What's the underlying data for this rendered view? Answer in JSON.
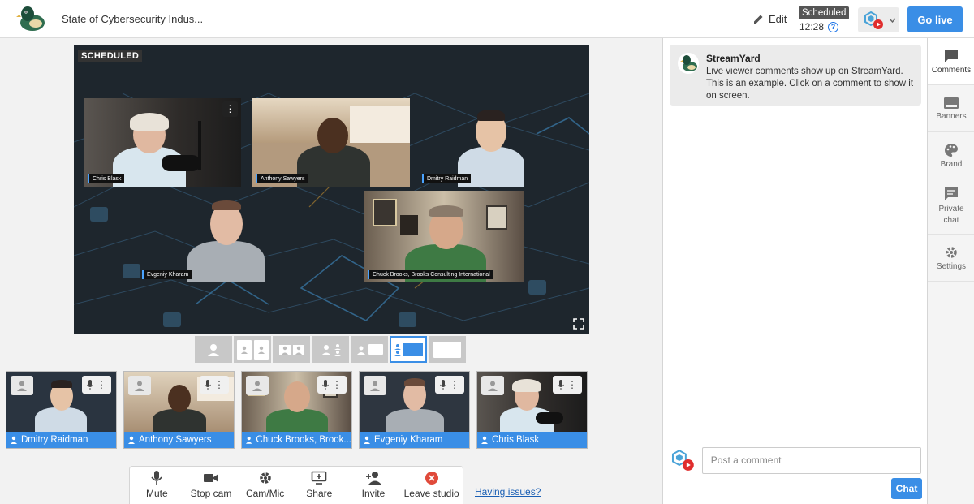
{
  "app": {
    "title": "State of Cybersecurity Indus...",
    "edit_label": "Edit",
    "status_badge": "Scheduled",
    "timer": "12:28",
    "go_live_label": "Go live",
    "brand_color": "#3a8ee6",
    "logo_icon": "streamyard-duck-icon"
  },
  "stage": {
    "status_label": "SCHEDULED",
    "tiles": [
      {
        "name": "Chris Blask"
      },
      {
        "name": "Anthony Sawyers"
      },
      {
        "name": "Dmitry Raidman"
      },
      {
        "name": "Evgeniy Kharam"
      },
      {
        "name": "Chuck Brooks, Brooks Consulting International"
      }
    ]
  },
  "layouts": {
    "options": [
      "solo",
      "cropped",
      "group",
      "thin",
      "leader",
      "sidebar",
      "fullscreen"
    ],
    "selected": "sidebar"
  },
  "participants": [
    {
      "name": "Dmitry Raidman"
    },
    {
      "name": "Anthony Sawyers"
    },
    {
      "name": "Chuck Brooks, Brook..."
    },
    {
      "name": "Evgeniy Kharam"
    },
    {
      "name": "Chris Blask"
    }
  ],
  "toolbar": {
    "mute": "Mute",
    "stop_cam": "Stop cam",
    "cam_mic": "Cam/Mic",
    "share": "Share",
    "invite": "Invite",
    "leave": "Leave studio",
    "issues_link": "Having issues?"
  },
  "chat": {
    "author": "StreamYard",
    "message": "Live viewer comments show up on StreamYard. This is an example. Click on a comment to show it on screen.",
    "input_placeholder": "Post a comment",
    "send_label": "Chat"
  },
  "sidetabs": {
    "comments": "Comments",
    "banners": "Banners",
    "brand": "Brand",
    "private_chat": "Private chat",
    "settings": "Settings"
  }
}
